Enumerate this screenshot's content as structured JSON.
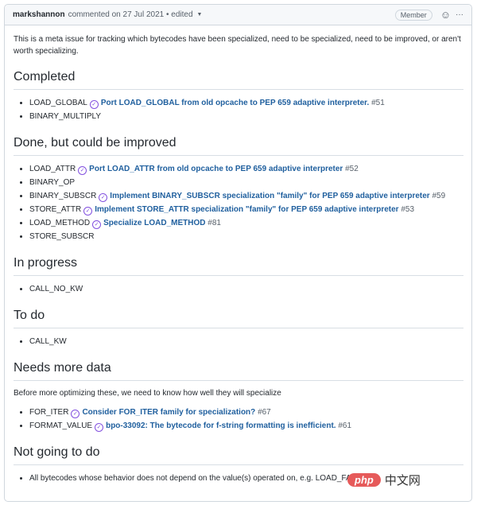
{
  "header": {
    "author": "markshannon",
    "meta": "commented on 27 Jul 2021 • edited",
    "role": "Member",
    "emoji_icon": "smiley-icon",
    "more_icon": "kebab-icon"
  },
  "intro": "This is a meta issue for tracking which bytecodes have been specialized, need to be specialized, need to be improved, or aren't worth specializing.",
  "sections": [
    {
      "title": "Completed",
      "items": [
        {
          "name": "LOAD_GLOBAL",
          "link": "Port LOAD_GLOBAL from old opcache to PEP 659 adaptive interpreter.",
          "num": "#51"
        },
        {
          "name": "BINARY_MULTIPLY"
        }
      ]
    },
    {
      "title": "Done, but could be improved",
      "items": [
        {
          "name": "LOAD_ATTR",
          "link": "Port LOAD_ATTR from old opcache to PEP 659 adaptive interpreter",
          "num": "#52"
        },
        {
          "name": "BINARY_OP"
        },
        {
          "name": "BINARY_SUBSCR",
          "link": "Implement BINARY_SUBSCR specialization \"family\" for PEP 659 adaptive interpreter",
          "num": "#59"
        },
        {
          "name": "STORE_ATTR",
          "link": "Implement STORE_ATTR specialization \"family\" for PEP 659 adaptive interpreter",
          "num": "#53"
        },
        {
          "name": "LOAD_METHOD",
          "link": "Specialize LOAD_METHOD",
          "num": "#81"
        },
        {
          "name": "STORE_SUBSCR"
        }
      ]
    },
    {
      "title": "In progress",
      "items": [
        {
          "name": "CALL_NO_KW"
        }
      ]
    },
    {
      "title": "To do",
      "items": [
        {
          "name": "CALL_KW"
        }
      ]
    },
    {
      "title": "Needs more data",
      "para": "Before more optimizing these, we need to know how well they will specialize",
      "items": [
        {
          "name": "FOR_ITER",
          "link": "Consider FOR_ITER family for specialization?",
          "num": "#67"
        },
        {
          "name": "FORMAT_VALUE",
          "link": "bpo-33092: The bytecode for f-string formatting is inefficient.",
          "num": "#61"
        }
      ]
    },
    {
      "title": "Not going to do",
      "items": [
        {
          "name": "All bytecodes whose behavior does not depend on the value(s) operated on, e.g. LOAD_FAST"
        }
      ]
    }
  ],
  "watermark": {
    "logo": "php",
    "text": "中文网"
  }
}
